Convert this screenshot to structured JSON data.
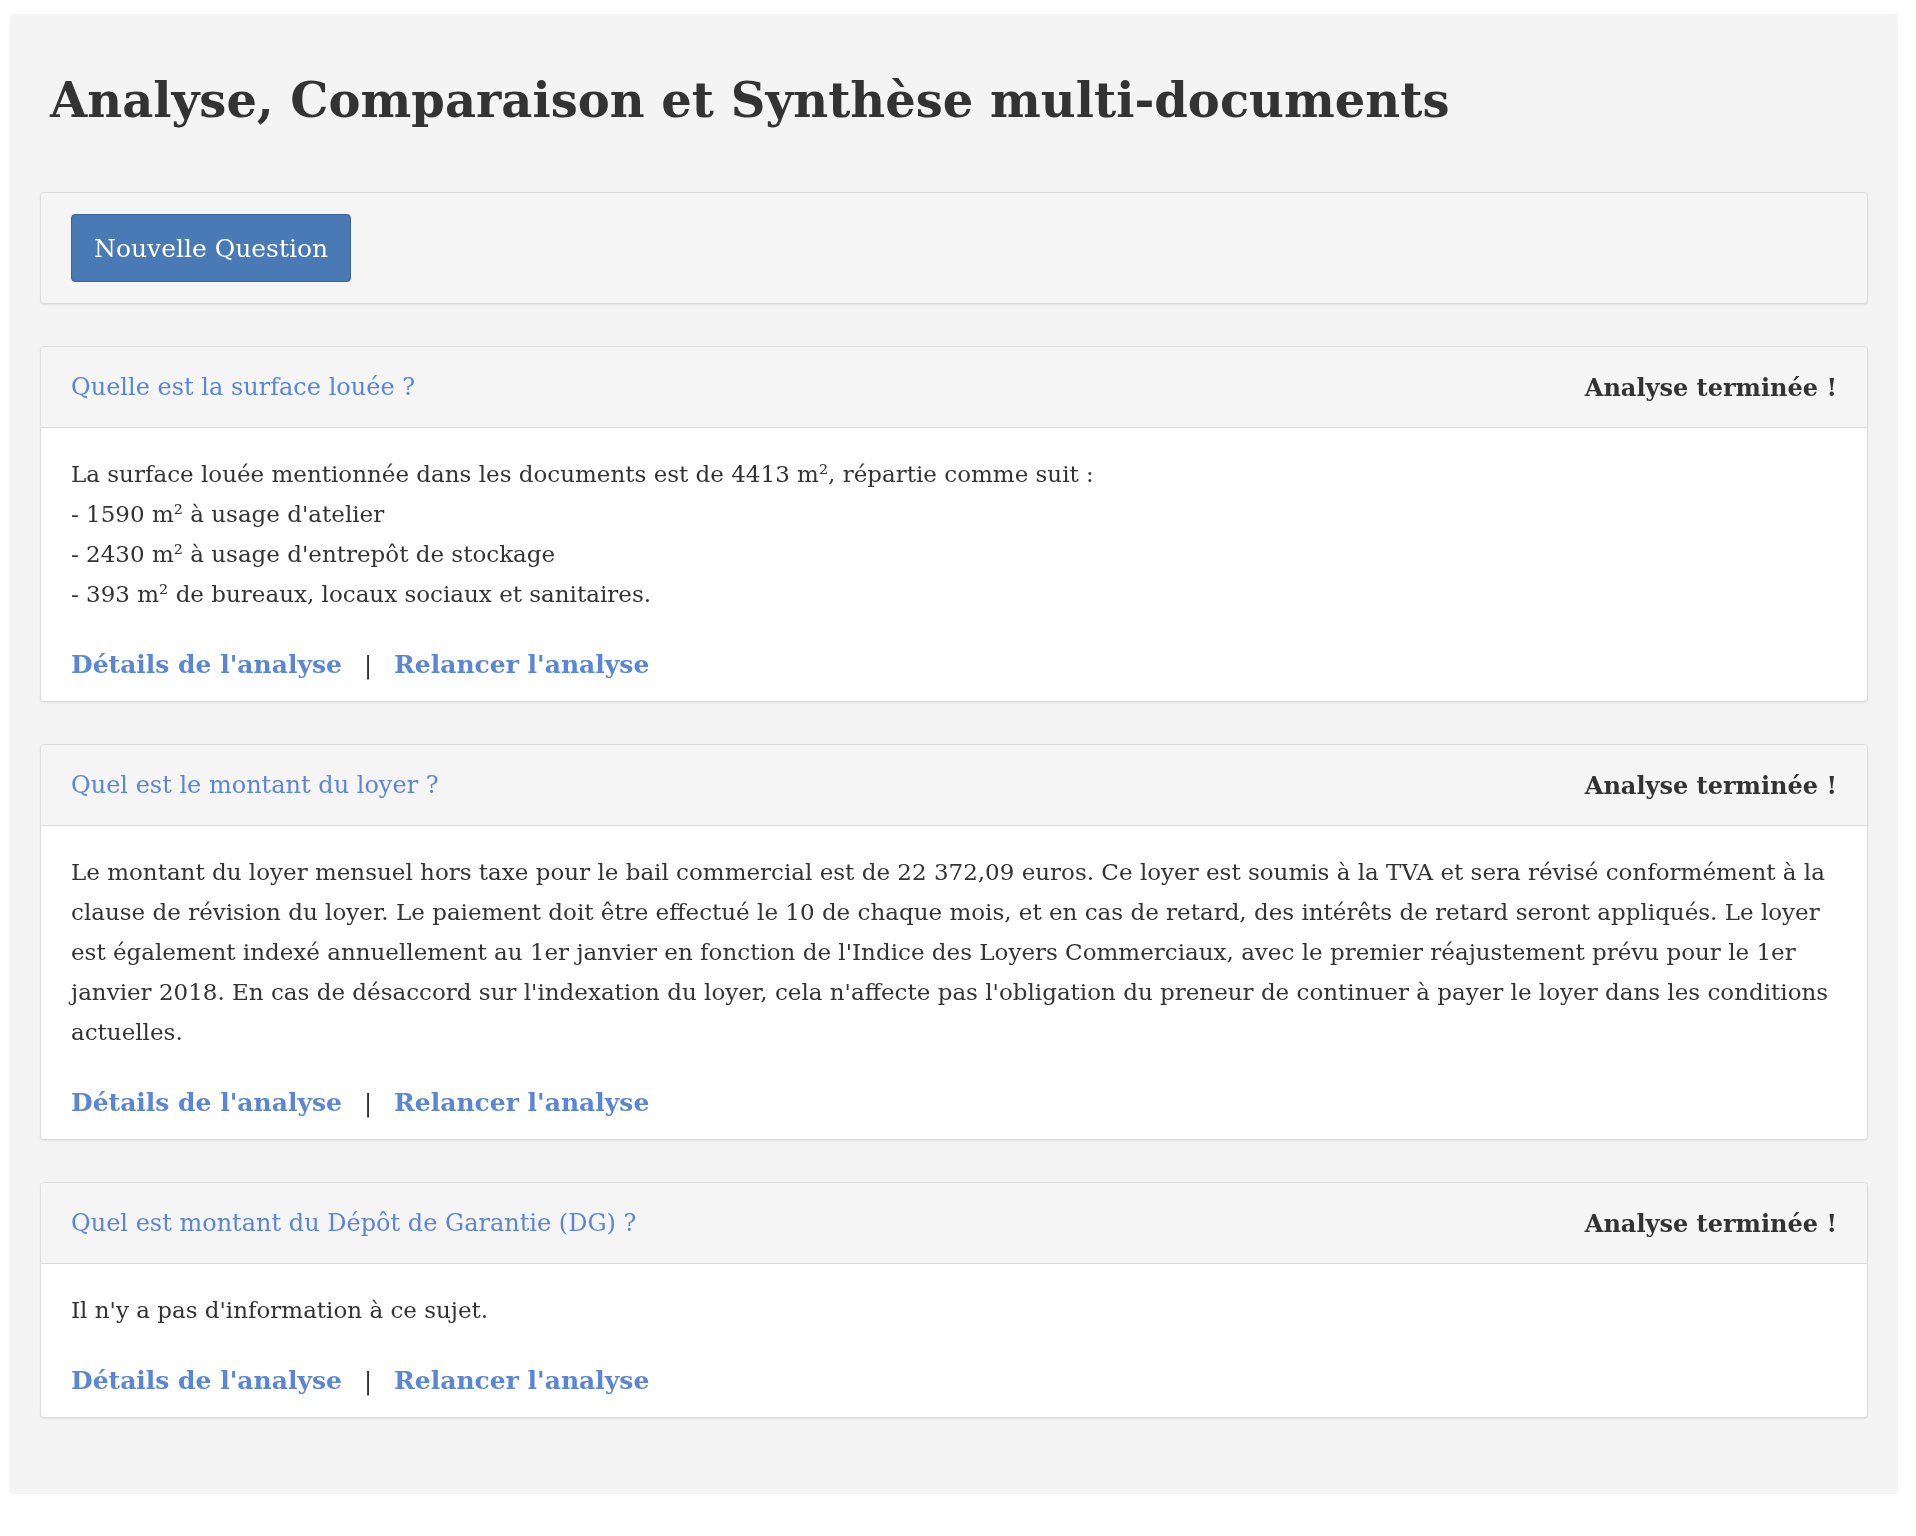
{
  "title": "Analyse, Comparaison et Synthèse multi-documents",
  "toolbar": {
    "button": "Nouvelle Question"
  },
  "questions": [
    {
      "question": "Quelle est la surface louée ?",
      "status": "Analyse terminée !",
      "answer_lines": [
        "La surface louée mentionnée dans les documents est de 4413 m², répartie comme suit :",
        "- 1590 m² à usage d'atelier",
        "- 2430 m² à usage d'entrepôt de stockage",
        "- 393 m² de bureaux, locaux sociaux et sanitaires."
      ],
      "links": [
        "Détails de l'analyse",
        "Relancer l'analyse"
      ],
      "separator": "|"
    },
    {
      "question": "Quel est le montant du loyer ?",
      "status": "Analyse terminée !",
      "answer_lines": [
        "Le montant du loyer mensuel hors taxe pour le bail commercial est de 22 372,09 euros. Ce loyer est soumis à la TVA et sera révisé conformément à la clause de révision du loyer. Le paiement doit être effectué le 10 de chaque mois, et en cas de retard, des intérêts de retard seront appliqués. Le loyer est également indexé annuellement au 1er janvier en fonction de l'Indice des Loyers Commerciaux, avec le premier réajustement prévu pour le 1er janvier 2018. En cas de désaccord sur l'indexation du loyer, cela n'affecte pas l'obligation du preneur de continuer à payer le loyer dans les conditions actuelles."
      ],
      "links": [
        "Détails de l'analyse",
        "Relancer l'analyse"
      ],
      "separator": "|"
    },
    {
      "question": "Quel est montant du Dépôt de Garantie (DG) ?",
      "status": "Analyse terminée !",
      "answer_lines": [
        "Il n'y a pas d'information à ce sujet."
      ],
      "links": [
        "Détails de l'analyse",
        "Relancer l'analyse"
      ],
      "separator": "|"
    }
  ]
}
